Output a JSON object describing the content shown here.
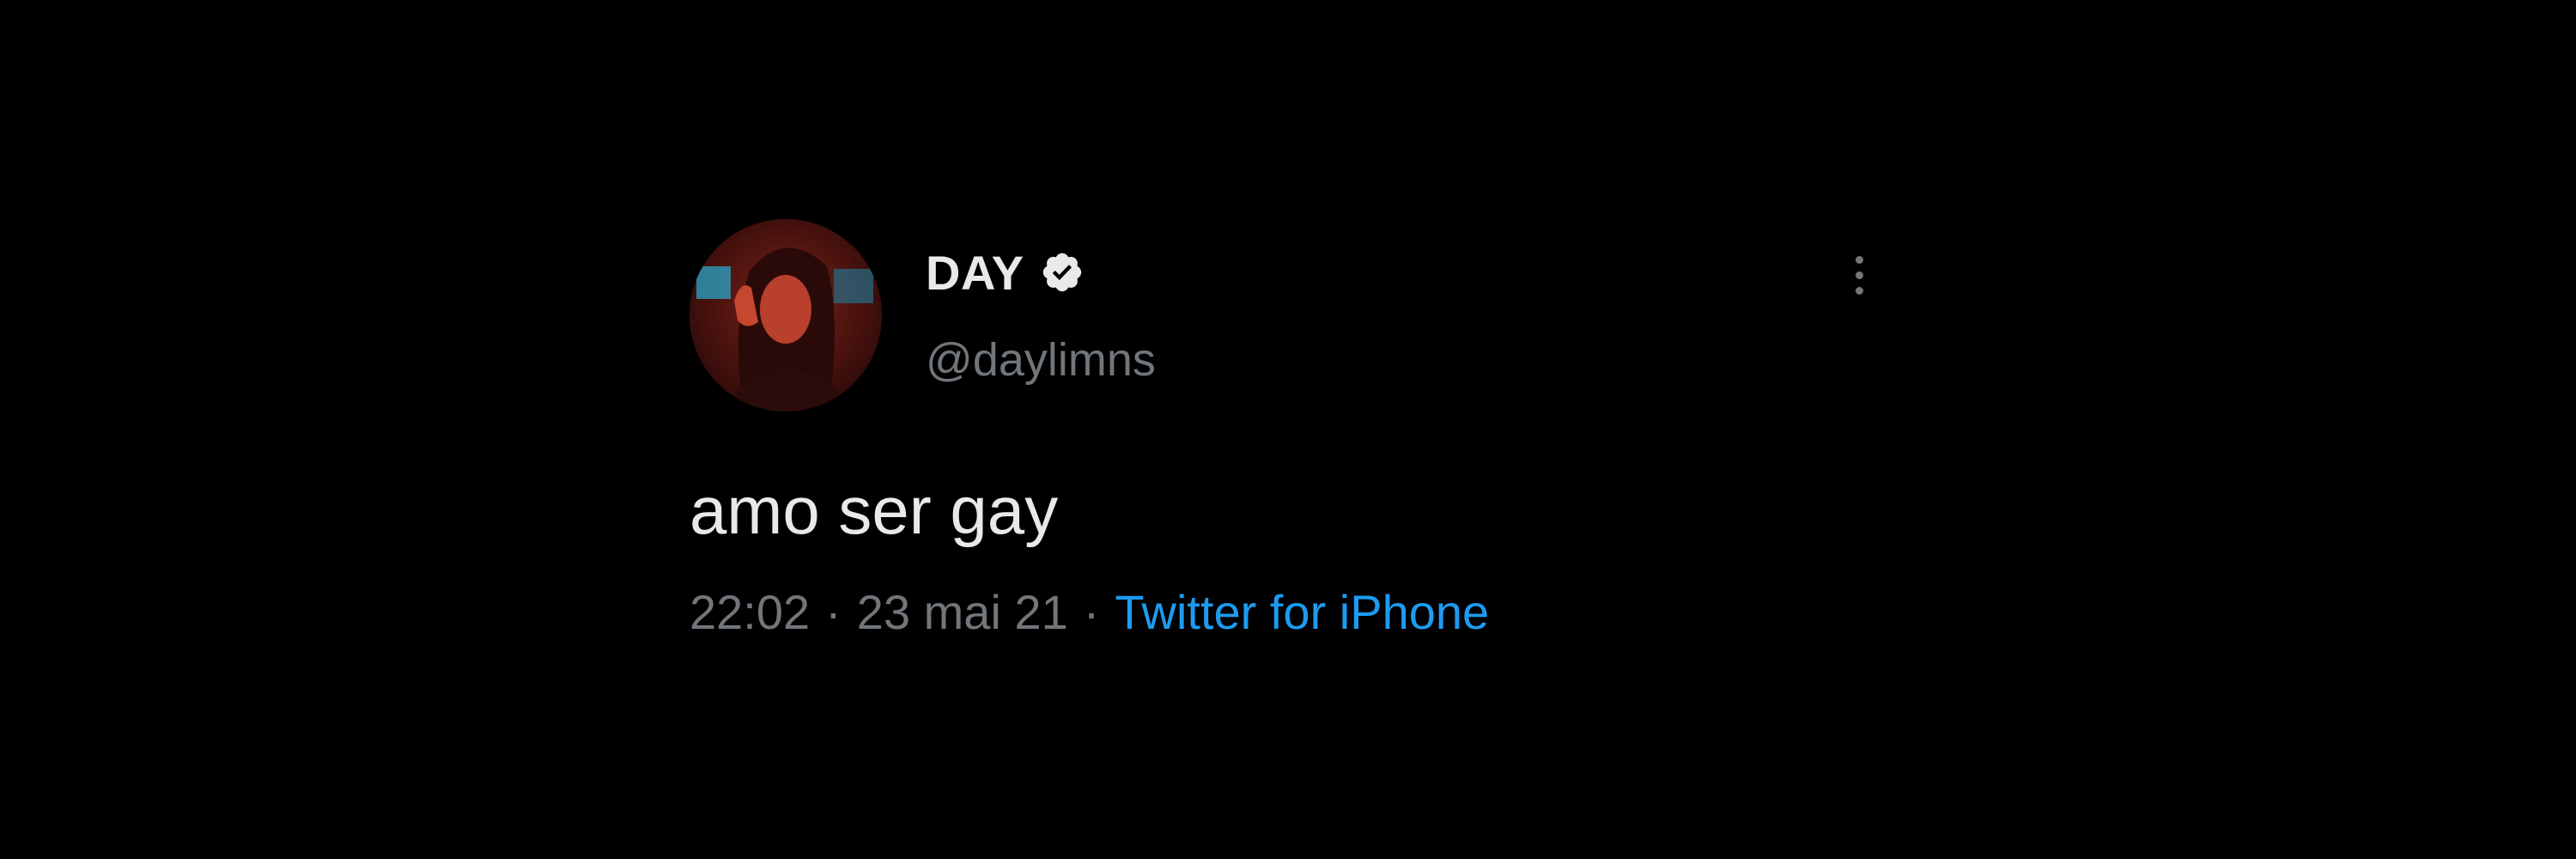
{
  "tweet": {
    "author": {
      "display_name": "DAY",
      "handle": "@daylimns",
      "verified": true,
      "avatar_icon": "profile-photo"
    },
    "text": "amo ser gay",
    "meta": {
      "time": "22:02",
      "separator": "·",
      "date": "23 mai 21",
      "source": "Twitter for iPhone"
    },
    "more_icon": "vertical-ellipsis-icon"
  },
  "colors": {
    "background": "#000000",
    "primary_text": "#e7e9ea",
    "secondary_text": "#71767b",
    "link": "#1d9bf0"
  }
}
